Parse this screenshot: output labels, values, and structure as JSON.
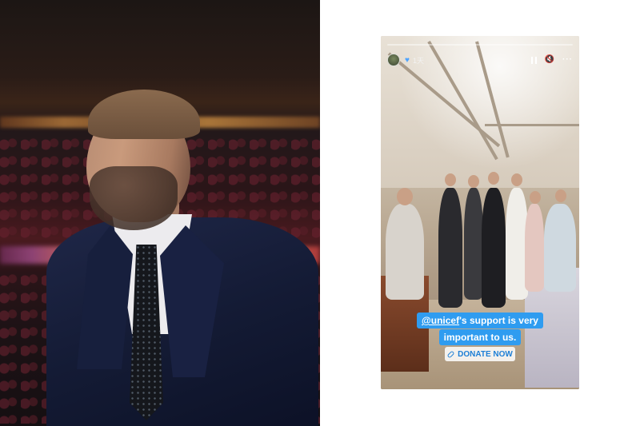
{
  "story": {
    "time": "1天",
    "caption_mention": "@unicef",
    "caption_rest_line1": "'s support is very",
    "caption_line2": "important to us.",
    "donate_label": "DONATE NOW",
    "icons": {
      "avatar": "profile-avatar",
      "badge": "heart-icon",
      "pause": "pause-icon",
      "mute": "speaker-muted-icon",
      "more": "more-icon",
      "link": "link-icon"
    }
  },
  "colors": {
    "caption_bg": "#2f9cf0",
    "donate_text": "#1e7fd6",
    "badge": "#4da3ff"
  }
}
